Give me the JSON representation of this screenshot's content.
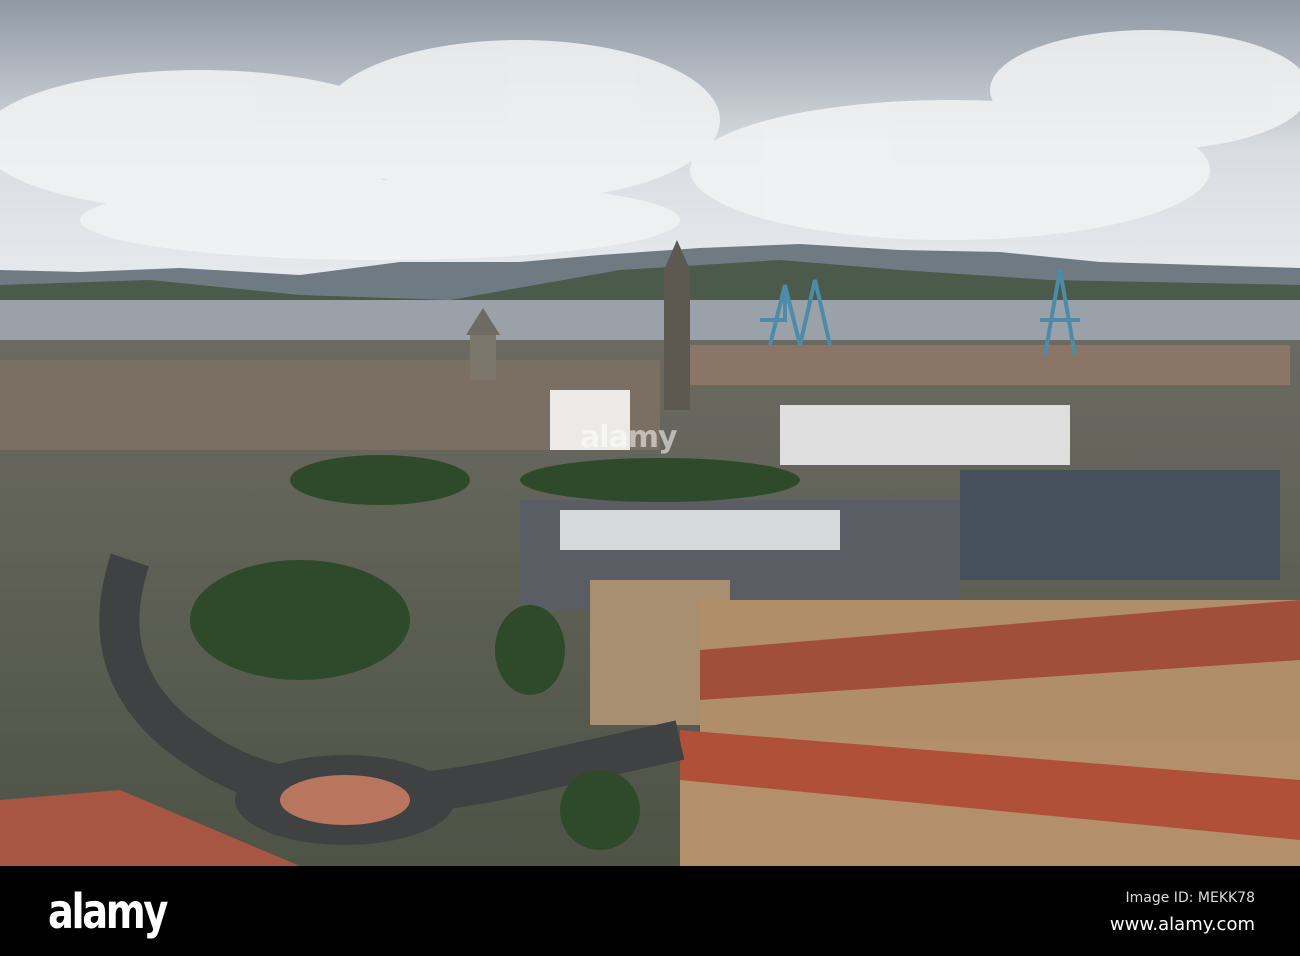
{
  "photo": {
    "subject": "Greenock town centre and River Clyde aerial view"
  },
  "watermark": {
    "text": "alamy"
  },
  "footer": {
    "logo": "alamy",
    "image_id": "Image ID: MEKK78",
    "url": "www.alamy.com"
  }
}
